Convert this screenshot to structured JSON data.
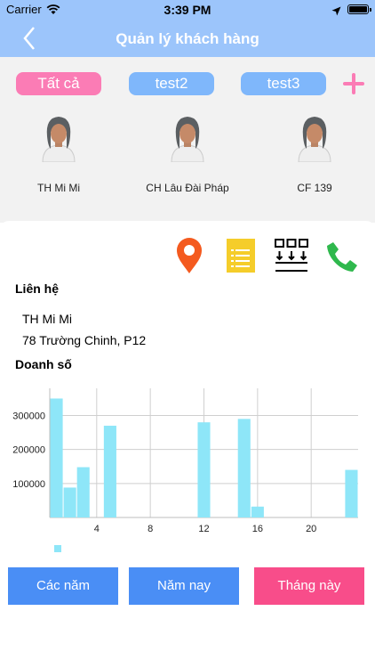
{
  "status_bar": {
    "carrier": "Carrier",
    "time": "3:39 PM"
  },
  "nav": {
    "title": "Quản lý khách hàng",
    "back_icon": "chevron-left-icon"
  },
  "tabs": [
    {
      "label": "Tất cả",
      "color": "#fb7cb5",
      "selected": true
    },
    {
      "label": "test2",
      "color": "#7fb7fb",
      "selected": false
    },
    {
      "label": "test3",
      "color": "#7fb7fb",
      "selected": false
    }
  ],
  "add_icon": "plus-icon",
  "customers": [
    {
      "name": "TH Mi Mi"
    },
    {
      "name": "CH Lâu Đài Pháp"
    },
    {
      "name": "CF 139"
    }
  ],
  "actions": [
    {
      "icon": "map-pin-icon",
      "color": "#f45a1f"
    },
    {
      "icon": "document-icon",
      "color": "#f5cd2a"
    },
    {
      "icon": "grid-download-icon",
      "color": "#000000"
    },
    {
      "icon": "phone-icon",
      "color": "#2fb84d"
    }
  ],
  "contact": {
    "label": "Liên hệ",
    "name": "TH Mi Mi",
    "address": "78 Trường Chinh, P12"
  },
  "sales": {
    "label": "Doanh số"
  },
  "chart_data": {
    "type": "bar",
    "title": "",
    "xlabel": "",
    "ylabel": "",
    "x": [
      1,
      2,
      3,
      5,
      12,
      15,
      16,
      23
    ],
    "values": [
      350000,
      88000,
      148000,
      270000,
      280000,
      290000,
      32000,
      140000
    ],
    "series_color": "#8ee6f8",
    "x_ticks": [
      4,
      8,
      12,
      16,
      20
    ],
    "y_ticks": [
      100000,
      200000,
      300000
    ],
    "xlim": [
      0.5,
      23.5
    ],
    "ylim": [
      0,
      380000
    ],
    "grid": true,
    "legend": {
      "position": "bottom-left",
      "entries": [
        ""
      ]
    }
  },
  "buttons": {
    "years": "Các năm",
    "this_year": "Năm nay",
    "this_month": "Tháng này"
  }
}
